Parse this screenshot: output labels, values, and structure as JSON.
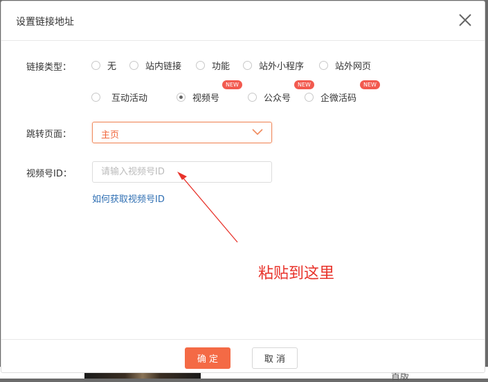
{
  "background": {
    "side_text": "首版"
  },
  "dialog": {
    "title": "设置链接地址",
    "link_type": {
      "label": "链接类型：",
      "options": [
        {
          "text": "无",
          "selected": false,
          "new": false
        },
        {
          "text": "站内链接",
          "selected": false,
          "new": false
        },
        {
          "text": "功能",
          "selected": false,
          "new": false
        },
        {
          "text": "站外小程序",
          "selected": false,
          "new": false
        },
        {
          "text": "站外网页",
          "selected": false,
          "new": false
        },
        {
          "text": "互动活动",
          "selected": false,
          "new": false
        },
        {
          "text": "视频号",
          "selected": true,
          "new": true
        },
        {
          "text": "公众号",
          "selected": false,
          "new": true
        },
        {
          "text": "企微活码",
          "selected": false,
          "new": true
        }
      ],
      "new_badge": "NEW"
    },
    "jump_page": {
      "label": "跳转页面：",
      "value": "主页"
    },
    "channel_id": {
      "label": "视频号ID：",
      "placeholder": "请输入视频号ID",
      "value": "",
      "help_link": "如何获取视频号ID"
    },
    "annotation": "粘贴到这里",
    "buttons": {
      "confirm": "确 定",
      "cancel": "取 消"
    }
  },
  "colors": {
    "accent": "#f46a45",
    "link": "#2f6fb3",
    "annotation": "#e8322a"
  }
}
